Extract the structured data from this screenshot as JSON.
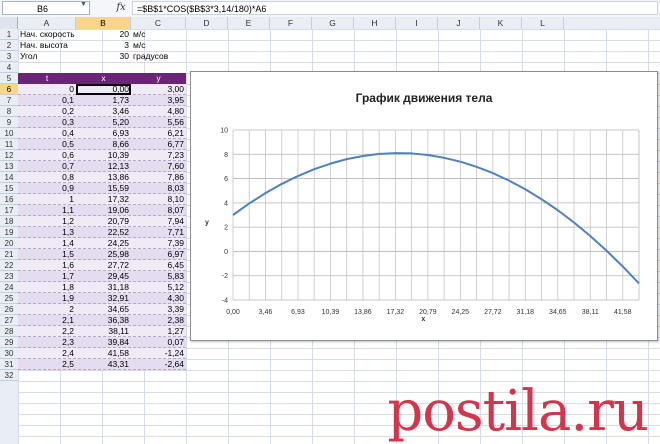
{
  "formula_bar": {
    "cell_ref": "B6",
    "fx": "fx",
    "formula": "=$B$1*COS($B$3*3,14/180)*A6"
  },
  "columns": [
    "A",
    "B",
    "C",
    "D",
    "E",
    "F",
    "G",
    "H",
    "I",
    "J",
    "K",
    "L"
  ],
  "selected_column": "B",
  "rows": [
    "1",
    "2",
    "3",
    "4",
    "5",
    "6",
    "7",
    "8",
    "9",
    "10",
    "11",
    "12",
    "13",
    "14",
    "15",
    "16",
    "17",
    "18",
    "19",
    "20",
    "21",
    "22",
    "23",
    "24",
    "25",
    "26",
    "27",
    "28",
    "29",
    "30",
    "31",
    "32"
  ],
  "selected_row": "6",
  "params": [
    {
      "label": "Нач. скорость",
      "value": "20",
      "unit": "м/с"
    },
    {
      "label": "Нач. высота",
      "value": "3",
      "unit": "м/с"
    },
    {
      "label": "Угол",
      "value": "30",
      "unit": "градусов"
    }
  ],
  "table": {
    "headers": [
      "t",
      "x",
      "y"
    ],
    "rows": [
      [
        "0",
        "0,00",
        "3,00"
      ],
      [
        "0,1",
        "1,73",
        "3,95"
      ],
      [
        "0,2",
        "3,46",
        "4,80"
      ],
      [
        "0,3",
        "5,20",
        "5,56"
      ],
      [
        "0,4",
        "6,93",
        "6,21"
      ],
      [
        "0,5",
        "8,66",
        "6,77"
      ],
      [
        "0,6",
        "10,39",
        "7,23"
      ],
      [
        "0,7",
        "12,13",
        "7,60"
      ],
      [
        "0,8",
        "13,86",
        "7,86"
      ],
      [
        "0,9",
        "15,59",
        "8,03"
      ],
      [
        "1",
        "17,32",
        "8,10"
      ],
      [
        "1,1",
        "19,06",
        "8,07"
      ],
      [
        "1,2",
        "20,79",
        "7,94"
      ],
      [
        "1,3",
        "22,52",
        "7,71"
      ],
      [
        "1,4",
        "24,25",
        "7,39"
      ],
      [
        "1,5",
        "25,98",
        "6,97"
      ],
      [
        "1,6",
        "27,72",
        "6,45"
      ],
      [
        "1,7",
        "29,45",
        "5,83"
      ],
      [
        "1,8",
        "31,18",
        "5,12"
      ],
      [
        "1,9",
        "32,91",
        "4,30"
      ],
      [
        "2",
        "34,65",
        "3,39"
      ],
      [
        "2,1",
        "36,38",
        "2,38"
      ],
      [
        "2,2",
        "38,11",
        "1,27"
      ],
      [
        "2,3",
        "39,84",
        "0,07"
      ],
      [
        "2,4",
        "41,58",
        "-1,24"
      ],
      [
        "2,5",
        "43,31",
        "-2,64"
      ]
    ]
  },
  "chart_data": {
    "type": "line",
    "title": "График движения тела",
    "xlabel": "x",
    "ylabel": "y",
    "ylim": [
      -4,
      10
    ],
    "yticks": [
      "10",
      "8",
      "6",
      "4",
      "2",
      "0",
      "-2",
      "-4"
    ],
    "xticks": [
      "0,00",
      "3,46",
      "6,93",
      "10,39",
      "13,86",
      "17,32",
      "20,79",
      "24,25",
      "27,72",
      "31,18",
      "34,65",
      "38,11",
      "41,58"
    ],
    "grid": true,
    "line_color": "#4f81bd",
    "series": [
      {
        "x": [
          0,
          1.73,
          3.46,
          5.2,
          6.93,
          8.66,
          10.39,
          12.13,
          13.86,
          15.59,
          17.32,
          19.06,
          20.79,
          22.52,
          24.25,
          25.98,
          27.72,
          29.45,
          31.18,
          32.91,
          34.65,
          36.38,
          38.11,
          39.84,
          41.58,
          43.31
        ],
        "values": [
          3.0,
          3.95,
          4.8,
          5.56,
          6.21,
          6.77,
          7.23,
          7.6,
          7.86,
          8.03,
          8.1,
          8.07,
          7.94,
          7.71,
          7.39,
          6.97,
          6.45,
          5.83,
          5.12,
          4.3,
          3.39,
          2.38,
          1.27,
          0.07,
          -1.24,
          -2.64
        ]
      }
    ]
  },
  "watermark": "postila.ru"
}
